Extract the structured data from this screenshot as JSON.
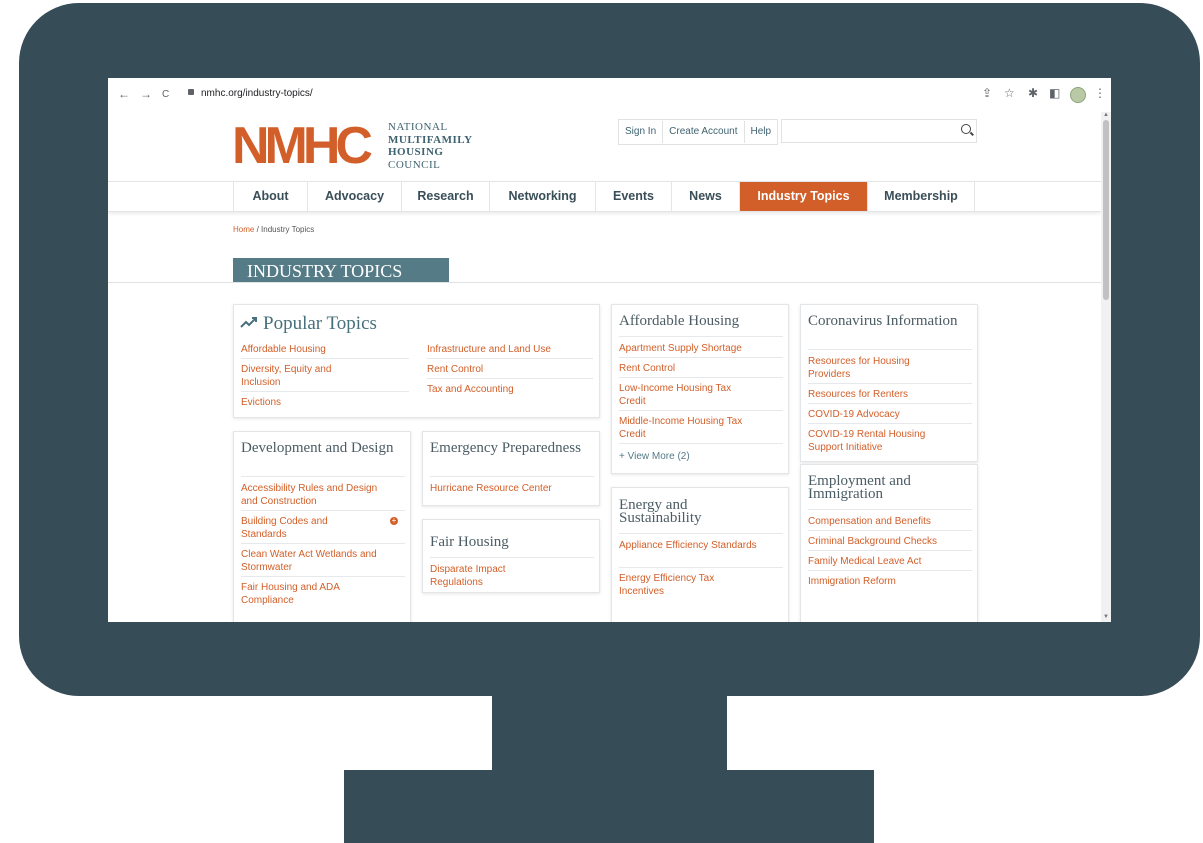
{
  "browser": {
    "url": "nmhc.org/industry-topics/",
    "back_icon": "←",
    "forward_icon": "→",
    "reload_icon": "C",
    "share_icon": "⇪",
    "star_icon": "☆",
    "extensions_icon": "✱",
    "sidepanel_icon": "◧",
    "menu_icon": "⋮"
  },
  "header": {
    "logo_mark": "NMHC",
    "logo_lines": [
      "NATIONAL",
      "MULTIFAMILY",
      "HOUSING",
      "COUNCIL"
    ],
    "sign_in": "Sign In",
    "create_account": "Create Account",
    "help": "Help",
    "search_value": ""
  },
  "nav": [
    {
      "label": "About",
      "active": false
    },
    {
      "label": "Advocacy",
      "active": false
    },
    {
      "label": "Research",
      "active": false
    },
    {
      "label": "Networking",
      "active": false
    },
    {
      "label": "Events",
      "active": false
    },
    {
      "label": "News",
      "active": false
    },
    {
      "label": "Industry Topics",
      "active": true
    },
    {
      "label": "Membership",
      "active": false
    }
  ],
  "breadcrumb": {
    "home": "Home",
    "sep": "/",
    "current": "Industry Topics"
  },
  "page_title": "INDUSTRY TOPICS",
  "popular": {
    "title": "Popular Topics",
    "col1": [
      "Affordable Housing",
      "Diversity, Equity and Inclusion",
      "Evictions"
    ],
    "col2": [
      "Infrastructure and Land Use",
      "Rent Control",
      "Tax and Accounting"
    ]
  },
  "development": {
    "title": "Development and Design",
    "items": [
      "Accessibility Rules and Design and Construction",
      "Building Codes and Standards",
      "Clean Water Act Wetlands and Stormwater",
      "Fair Housing and ADA Compliance"
    ],
    "expand_symbol": "+"
  },
  "emergency": {
    "title": "Emergency Preparedness",
    "items": [
      "Hurricane Resource Center"
    ]
  },
  "fair_housing": {
    "title": "Fair Housing",
    "items": [
      "Disparate Impact Regulations"
    ]
  },
  "affordable": {
    "title": "Affordable Housing",
    "items": [
      "Apartment Supply Shortage",
      "Rent Control",
      "Low-Income Housing Tax Credit",
      "Middle-Income Housing Tax Credit"
    ],
    "view_more": "+ View More (2)"
  },
  "energy": {
    "title": "Energy and Sustainability",
    "items": [
      "Appliance Efficiency Standards",
      "Energy Efficiency Tax Incentives"
    ]
  },
  "coronavirus": {
    "title": "Coronavirus Information",
    "items": [
      "Resources for Housing Providers",
      "Resources for Renters",
      "COVID-19 Advocacy",
      "COVID-19 Rental Housing Support Initiative"
    ]
  },
  "employment": {
    "title": "Employment and Immigration",
    "items": [
      "Compensation and Benefits",
      "Criminal Background Checks",
      "Family Medical Leave Act",
      "Immigration Reform"
    ]
  },
  "colors": {
    "accent": "#d25f29",
    "slate": "#364c57",
    "title_bar": "#557b86"
  }
}
